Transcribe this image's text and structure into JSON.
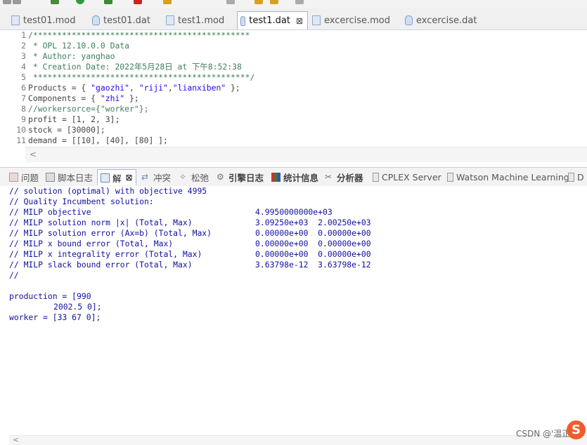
{
  "editor_tabs": [
    {
      "label": "test01.mod",
      "icon": "mod-file-icon",
      "active": false
    },
    {
      "label": "test01.dat",
      "icon": "dat-file-icon",
      "active": false
    },
    {
      "label": "test1.mod",
      "icon": "mod-file-icon",
      "active": false
    },
    {
      "label": "test1.dat",
      "icon": "dat-file-icon",
      "active": true,
      "close": "⊠"
    },
    {
      "label": "excercise.mod",
      "icon": "mod-file-icon",
      "active": false
    },
    {
      "label": "excercise.dat",
      "icon": "dat-file-icon",
      "active": false
    }
  ],
  "code": {
    "line_numbers": [
      "1",
      "2",
      "3",
      "4",
      "5",
      "6",
      "7",
      "8",
      "9",
      "10",
      "11"
    ],
    "l1": "/*********************************************",
    "l2": " * OPL 12.10.0.0 Data",
    "l3": " * Author: yanghao",
    "l4": " * Creation Date: 2022年5月28日 at 下午8:52:38",
    "l5": " *********************************************/",
    "l6_a": "Products = { ",
    "l6_s1": "\"gaozhi\"",
    "l6_b": ", ",
    "l6_s2": "\"riji\"",
    "l6_c": ",",
    "l6_s3": "\"lianxiben\"",
    "l6_d": " };",
    "l7_a": "Components = { ",
    "l7_s1": "\"zhi\"",
    "l7_b": " };",
    "l8": "//workersorce={\"worker\"};",
    "l9": "profit = [1, 2, 3];",
    "l10": "stock = [30000];",
    "l11": "demand = [[10], [40], [80] ];"
  },
  "panel_tabs": [
    {
      "label": "问题",
      "icon": "problems-icon"
    },
    {
      "label": "脚本日志",
      "icon": "script-log-icon"
    },
    {
      "label": "解",
      "icon": "solution-icon",
      "active": true,
      "close": "⊠"
    },
    {
      "label": "冲突",
      "icon": "conflicts-icon"
    },
    {
      "label": "松弛",
      "icon": "relaxation-icon"
    },
    {
      "label": "引擎日志",
      "icon": "engine-log-icon"
    },
    {
      "label": "统计信息",
      "icon": "statistics-icon"
    },
    {
      "label": "分析器",
      "icon": "profiler-icon"
    },
    {
      "label": "CPLEX Server",
      "icon": "cplex-server-icon"
    },
    {
      "label": "Watson Machine Learning",
      "icon": "watson-icon"
    },
    {
      "label": "D",
      "icon": "more-icon"
    }
  ],
  "output": {
    "lines": [
      "// solution (optimal) with objective 4995",
      "// Quality Incumbent solution:",
      "// MILP objective",
      "// MILP solution norm |x| (Total, Max)",
      "// MILP solution error (Ax=b) (Total, Max)",
      "// MILP x bound error (Total, Max)",
      "// MILP x integrality error (Total, Max)",
      "// MILP slack bound error (Total, Max)",
      "//"
    ],
    "values": [
      "4.9950000000e+03",
      "3.09250e+03  2.00250e+03",
      "0.00000e+00  0.00000e+00",
      "0.00000e+00  0.00000e+00",
      "0.00000e+00  0.00000e+00",
      "3.63798e-12  3.63798e-12"
    ],
    "result1": "production = [990",
    "result2": "2002.5 0];",
    "result3": "worker = [33 67 0];"
  },
  "watermark": "CSDN @'温正",
  "logo_letter": "S",
  "colors": {
    "comment": "#3f7f5f",
    "string": "#2a00ff",
    "output_text": "#1010a0"
  }
}
